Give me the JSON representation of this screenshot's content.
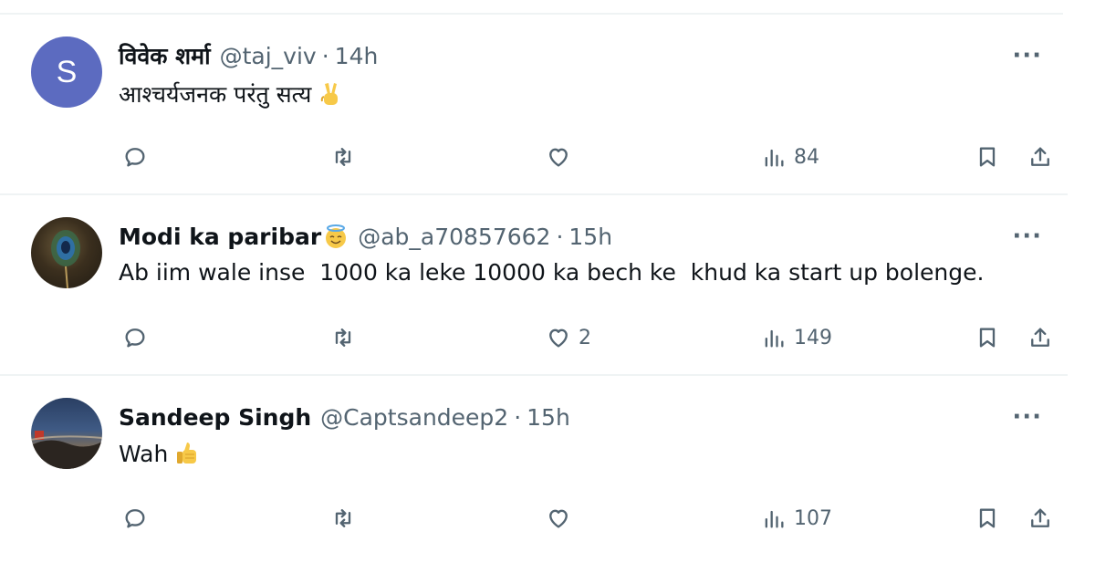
{
  "tweets": [
    {
      "avatar_letter": "S",
      "avatar_color": "#5c6bc0",
      "name": "विवेक शर्मा",
      "handle": "@taj_viv",
      "time": "14h",
      "text": "आश्चर्यजनक परंतु सत्य",
      "text_emoji": "victory-hand-icon",
      "likes": "",
      "views": "84"
    },
    {
      "avatar_letter": "",
      "name": "Modi ka paribar",
      "name_emoji": "smiling-face-with-halo-icon",
      "handle": "@ab_a70857662",
      "time": "15h",
      "text": "Ab iim wale inse  1000 ka leke 10000 ka bech ke  khud ka start up bolenge.",
      "likes": "2",
      "views": "149"
    },
    {
      "avatar_letter": "",
      "name": "Sandeep Singh",
      "handle": "@Captsandeep2",
      "time": "15h",
      "text": "Wah",
      "text_emoji": "thumbs-up-icon",
      "likes": "",
      "views": "107"
    }
  ],
  "separator": "·",
  "more_label": "···",
  "colors": {
    "text_primary": "#0f1419",
    "text_secondary": "#536471",
    "divider": "#eff3f4"
  }
}
